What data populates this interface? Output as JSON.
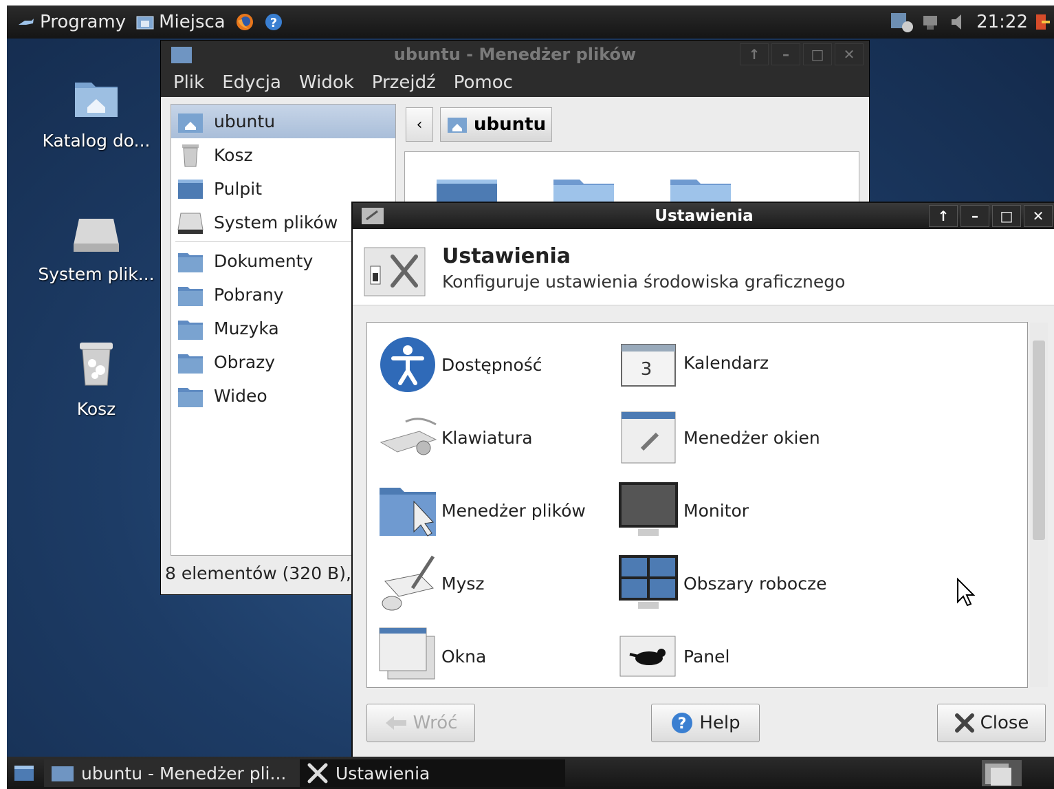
{
  "top_panel": {
    "menu_programs": "Programy",
    "menu_places": "Miejsca",
    "clock": "21:22"
  },
  "desktop_icons": [
    {
      "label": "Katalog do...",
      "icon": "home-folder-icon"
    },
    {
      "label": "System plik...",
      "icon": "drive-icon"
    },
    {
      "label": "Kosz",
      "icon": "trash-icon"
    }
  ],
  "file_manager": {
    "title": "ubuntu - Menedżer plików",
    "menu": [
      "Plik",
      "Edycja",
      "Widok",
      "Przejdź",
      "Pomoc"
    ],
    "sidebar": {
      "devices": [
        {
          "label": "ubuntu",
          "icon": "home-folder-icon"
        },
        {
          "label": "Kosz",
          "icon": "trash-icon"
        },
        {
          "label": "Pulpit",
          "icon": "desktop-icon"
        },
        {
          "label": "System plików",
          "icon": "drive-icon"
        }
      ],
      "places": [
        {
          "label": "Dokumenty"
        },
        {
          "label": "Pobrany"
        },
        {
          "label": "Muzyka"
        },
        {
          "label": "Obrazy"
        },
        {
          "label": "Wideo"
        }
      ]
    },
    "path_button": "ubuntu",
    "status": "8 elementów (320 B),"
  },
  "settings": {
    "title": "Ustawienia",
    "heading": "Ustawienia",
    "subtitle": "Konfiguruje ustawienia środowiska graficznego",
    "items": [
      {
        "label": "Dostępność",
        "icon": "accessibility-icon"
      },
      {
        "label": "Kalendarz",
        "icon": "calendar-icon"
      },
      {
        "label": "Klawiatura",
        "icon": "keyboard-icon"
      },
      {
        "label": "Menedżer okien",
        "icon": "window-manager-icon"
      },
      {
        "label": "Menedżer plików",
        "icon": "file-manager-icon"
      },
      {
        "label": "Monitor",
        "icon": "monitor-icon"
      },
      {
        "label": "Mysz",
        "icon": "mouse-icon"
      },
      {
        "label": "Obszary robocze",
        "icon": "workspaces-icon"
      },
      {
        "label": "Okna",
        "icon": "windows-icon"
      },
      {
        "label": "Panel",
        "icon": "panel-icon"
      }
    ],
    "buttons": {
      "back": "Wróć",
      "help": "Help",
      "close": "Close"
    }
  },
  "taskbar": {
    "tasks": [
      {
        "label": "ubuntu - Menedżer pli..."
      },
      {
        "label": "Ustawienia"
      }
    ]
  }
}
